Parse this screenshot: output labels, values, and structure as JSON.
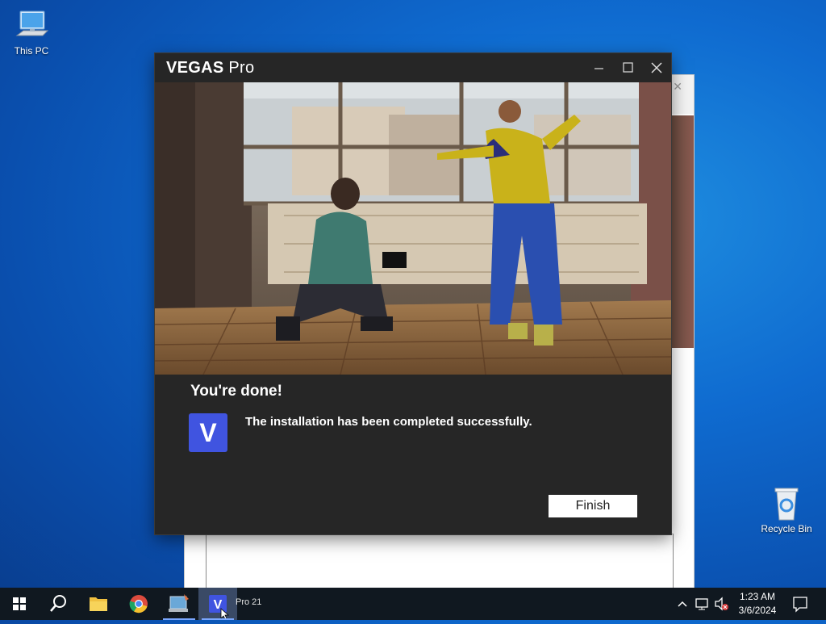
{
  "desktop": {
    "icons": [
      {
        "label": "This PC",
        "icon": "computer-icon"
      },
      {
        "label": "Recycle Bin",
        "icon": "recycle-bin-icon"
      }
    ]
  },
  "dialog": {
    "title_bold": "VEGAS",
    "title_light": "Pro",
    "heading": "You're done!",
    "logo_letter": "V",
    "message": "The installation has been completed successfully.",
    "finish_label": "Finish",
    "accent": "#4054e0",
    "background": "#262626"
  },
  "window_controls": {
    "minimize": "—",
    "maximize": "☐",
    "close": "✕"
  },
  "background_window": {
    "close": "✕"
  },
  "taskbar": {
    "apps": [
      {
        "name": "start-button",
        "icon": "windows-icon"
      },
      {
        "name": "search-button",
        "icon": "search-icon"
      },
      {
        "name": "file-explorer",
        "icon": "folder-icon"
      },
      {
        "name": "chrome",
        "icon": "chrome-icon"
      },
      {
        "name": "installer",
        "icon": "installer-icon"
      },
      {
        "name": "vegas-pro",
        "icon": "vegas-icon"
      }
    ],
    "active_label": "Pro 21",
    "clock_time": "1:23 AM",
    "clock_date": "3/6/2024"
  }
}
